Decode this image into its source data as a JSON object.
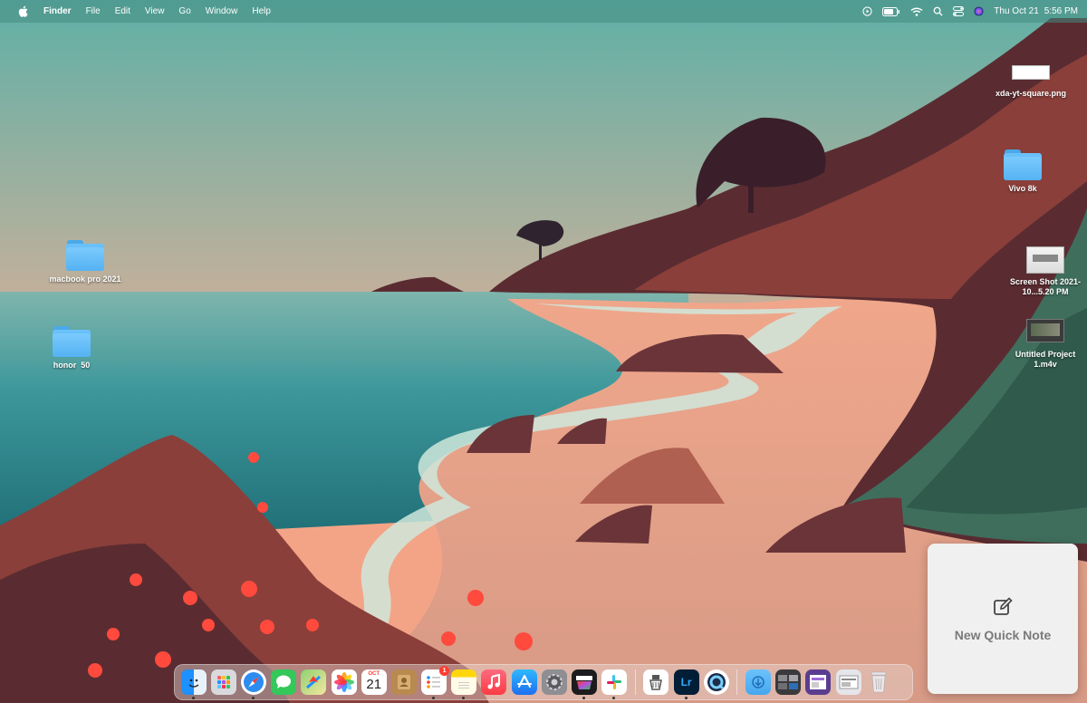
{
  "menubar": {
    "app_name": "Finder",
    "menus": [
      "File",
      "Edit",
      "View",
      "Go",
      "Window",
      "Help"
    ],
    "status_icons": [
      "play-circle-icon",
      "battery-icon",
      "wifi-icon",
      "spotlight-search-icon",
      "control-center-icon",
      "siri-icon"
    ],
    "clock": {
      "date": "Thu Oct 21",
      "time": "5:56 PM"
    }
  },
  "desktop": {
    "icons": [
      {
        "label": "xda-yt-square.png",
        "kind": "image"
      },
      {
        "label": "Vivo 8k",
        "kind": "folder"
      },
      {
        "label": "macbook pro 2021",
        "kind": "folder"
      },
      {
        "label": "Screen Shot 2021-10...5.20 PM",
        "kind": "image"
      },
      {
        "label": "Untitled Project 1.m4v",
        "kind": "video"
      },
      {
        "label": "honor  50",
        "kind": "folder"
      }
    ]
  },
  "quick_note": {
    "label": "New Quick Note"
  },
  "dock": {
    "calendar": {
      "month": "OCT",
      "day": "21"
    },
    "reminders_badge": "1",
    "apps": [
      "finder-icon",
      "launchpad-icon",
      "safari-icon",
      "messages-icon",
      "maps-icon",
      "photos-icon",
      "calendar-icon",
      "contacts-icon",
      "reminders-icon",
      "notes-icon",
      "music-icon",
      "app-store-icon",
      "system-preferences-icon",
      "final-cut-pro-icon",
      "slack-icon",
      "capture-icon",
      "lightroom-icon",
      "quicktime-icon",
      "downloads-stack-icon",
      "trash-icon"
    ]
  },
  "colors": {
    "sky_top": "#6fb9ad",
    "sky_bottom": "#f3a487",
    "sea": "#2f8a8c",
    "sand": "#e9a58b",
    "cliff": "#5e2f33"
  }
}
